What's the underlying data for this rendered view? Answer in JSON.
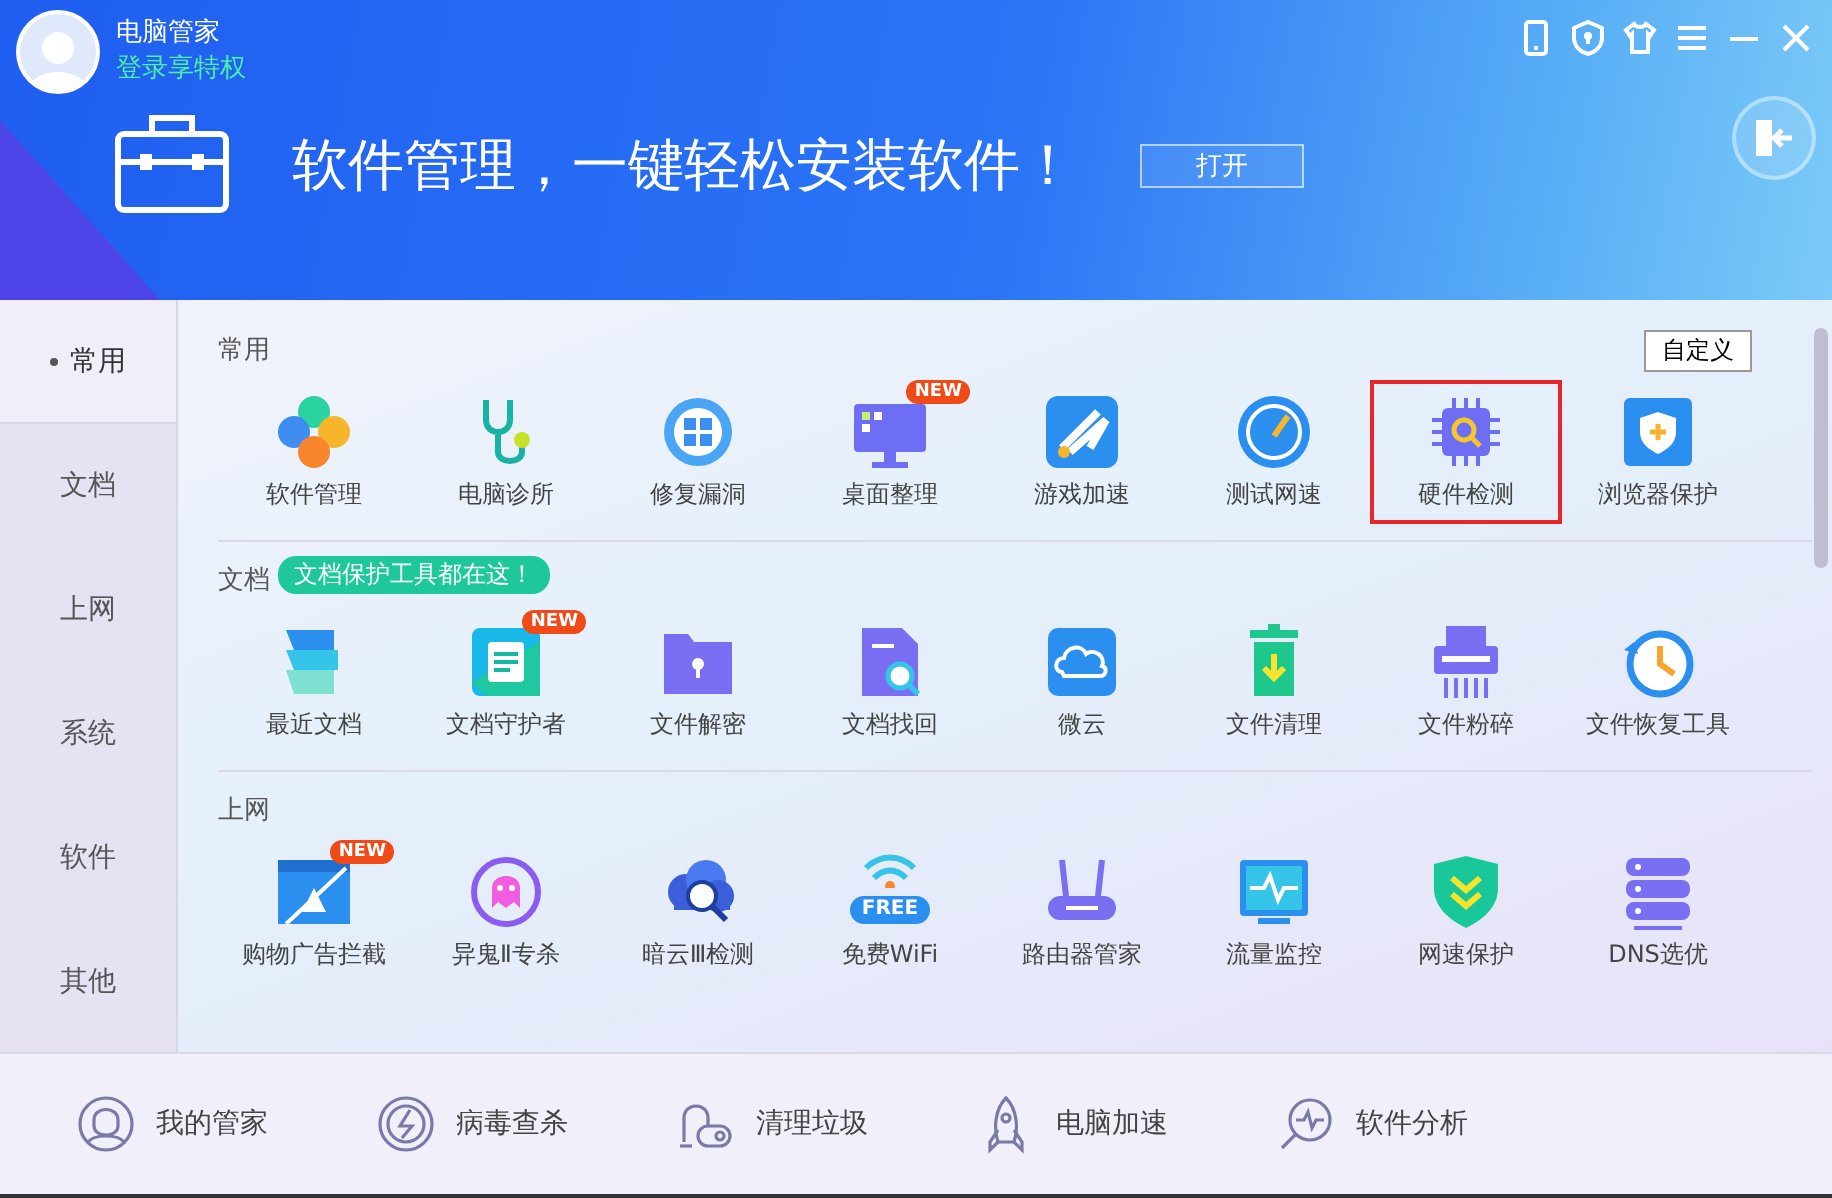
{
  "header": {
    "app_name": "电脑管家",
    "login_link": "登录享特权",
    "banner_text": "软件管理，一键轻松安装软件！",
    "open_button": "打开"
  },
  "sidebar": {
    "items": [
      {
        "label": "常用",
        "selected": true
      },
      {
        "label": "文档",
        "selected": false
      },
      {
        "label": "上网",
        "selected": false
      },
      {
        "label": "系统",
        "selected": false
      },
      {
        "label": "软件",
        "selected": false
      },
      {
        "label": "其他",
        "selected": false
      }
    ]
  },
  "customize_button": "自定义",
  "sections": [
    {
      "title": "常用",
      "items": [
        {
          "label": "软件管理",
          "selected": false
        },
        {
          "label": "电脑诊所",
          "selected": false
        },
        {
          "label": "修复漏洞",
          "selected": false
        },
        {
          "label": "桌面整理",
          "badge": "NEW",
          "selected": false
        },
        {
          "label": "游戏加速",
          "selected": false
        },
        {
          "label": "测试网速",
          "selected": false
        },
        {
          "label": "硬件检测",
          "selected": true
        },
        {
          "label": "浏览器保护",
          "selected": false
        }
      ]
    },
    {
      "title": "文档",
      "tip": "文档保护工具都在这！",
      "items": [
        {
          "label": "最近文档",
          "selected": false
        },
        {
          "label": "文档守护者",
          "badge": "NEW",
          "selected": false
        },
        {
          "label": "文件解密",
          "selected": false
        },
        {
          "label": "文档找回",
          "selected": false
        },
        {
          "label": "微云",
          "selected": false
        },
        {
          "label": "文件清理",
          "selected": false
        },
        {
          "label": "文件粉碎",
          "selected": false
        },
        {
          "label": "文件恢复工具",
          "selected": false
        }
      ]
    },
    {
      "title": "上网",
      "items": [
        {
          "label": "购物广告拦截",
          "badge": "NEW",
          "selected": false
        },
        {
          "label": "异鬼Ⅱ专杀",
          "selected": false
        },
        {
          "label": "暗云Ⅲ检测",
          "selected": false
        },
        {
          "label": "免费WiFi",
          "icon_text": "FREE",
          "selected": false
        },
        {
          "label": "路由器管家",
          "selected": false
        },
        {
          "label": "流量监控",
          "selected": false
        },
        {
          "label": "网速保护",
          "selected": false
        },
        {
          "label": "DNS选优",
          "selected": false
        }
      ]
    }
  ],
  "bottom_nav": [
    {
      "label": "我的管家"
    },
    {
      "label": "病毒查杀"
    },
    {
      "label": "清理垃圾"
    },
    {
      "label": "电脑加速"
    },
    {
      "label": "软件分析"
    }
  ]
}
